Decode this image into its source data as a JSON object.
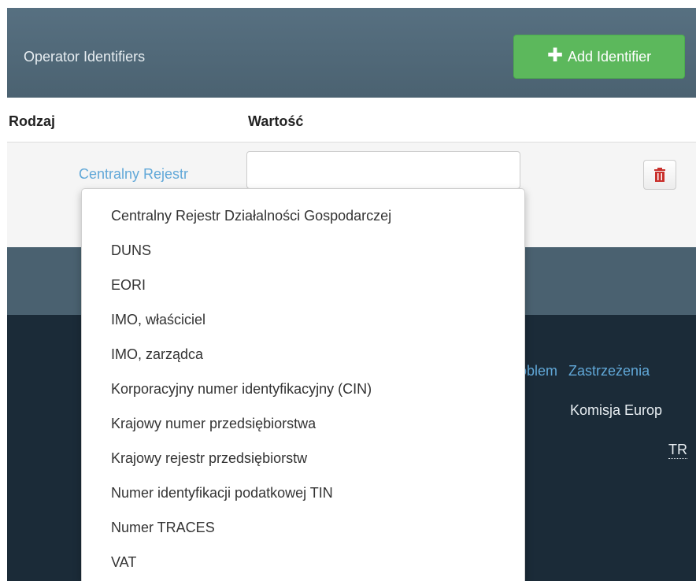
{
  "header": {
    "title": "Operator Identifiers",
    "add_button_label": "Add Identifier"
  },
  "table": {
    "columns": [
      "Rodzaj",
      "Wartość"
    ],
    "row": {
      "type_label": "Centralny Rejestr",
      "value": ""
    }
  },
  "dropdown": {
    "options": [
      "Centralny Rejestr Działalności Gospodarczej",
      "DUNS",
      "EORI",
      "IMO, właściciel",
      "IMO, zarządca",
      "Korporacyjny numer identyfikacyjny (CIN)",
      "Krajowy numer przedsiębiorstwa",
      "Krajowy rejestr przedsiębiorstw",
      "Numer identyfikacji podatkowej TIN",
      "Numer TRACES",
      "VAT"
    ]
  },
  "footer": {
    "link_partial_1": "oblem",
    "link_partial_2": "Zastrzeżenia",
    "org_partial": "Komisja Europ",
    "abbr_partial": "TR"
  },
  "colors": {
    "header_bg": "#4f6676",
    "add_button": "#5cb85c",
    "link": "#61a8d8",
    "footer_bg": "#1b2b38",
    "delete_icon": "#c9302c"
  },
  "icons": {
    "add": "plus-icon",
    "delete": "trash-icon"
  }
}
